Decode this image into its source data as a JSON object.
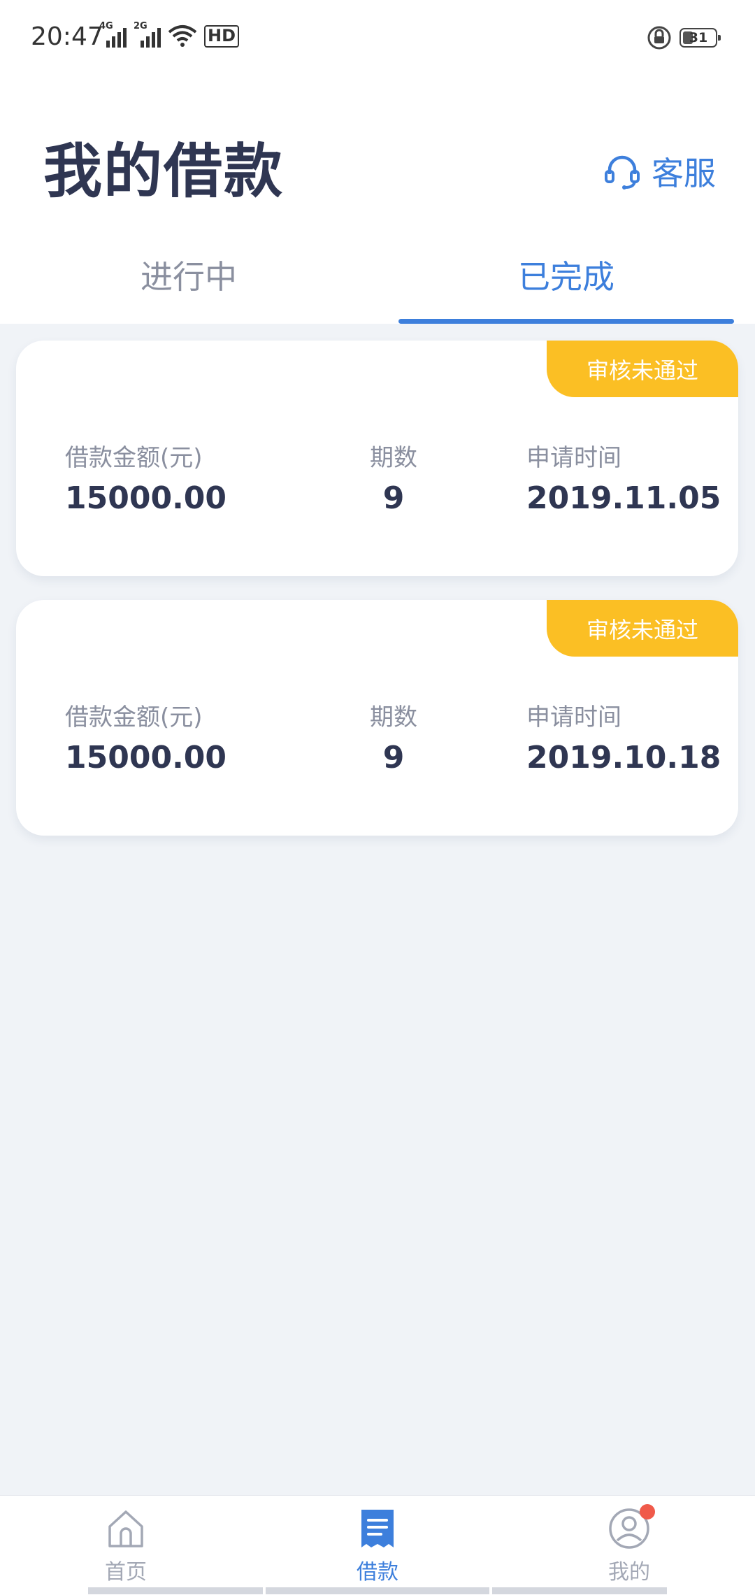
{
  "status_bar": {
    "time": "20:47",
    "signal_1_label": "4G",
    "signal_2_label": "2G",
    "hd_label": "HD",
    "battery_level": "31"
  },
  "header": {
    "title": "我的借款",
    "customer_service_label": "客服"
  },
  "tabs": [
    {
      "label": "进行中",
      "active": false
    },
    {
      "label": "已完成",
      "active": true
    }
  ],
  "loans": [
    {
      "status": "审核未通过",
      "amount_label": "借款金额(元)",
      "amount": "15000.00",
      "periods_label": "期数",
      "periods": "9",
      "date_label": "申请时间",
      "date": "2019.11.05"
    },
    {
      "status": "审核未通过",
      "amount_label": "借款金额(元)",
      "amount": "15000.00",
      "periods_label": "期数",
      "periods": "9",
      "date_label": "申请时间",
      "date": "2019.10.18"
    }
  ],
  "bottom_nav": [
    {
      "label": "首页",
      "icon": "home-icon",
      "active": false
    },
    {
      "label": "借款",
      "icon": "loan-document-icon",
      "active": true
    },
    {
      "label": "我的",
      "icon": "user-profile-icon",
      "active": false,
      "has_notification_dot": true
    }
  ],
  "colors": {
    "accent": "#3d7fdc",
    "badge": "#fbbf24",
    "title_text": "#2f3652",
    "muted_text": "#8a8f9f",
    "background": "#f0f3f7",
    "notification_dot": "#f05a4a"
  }
}
